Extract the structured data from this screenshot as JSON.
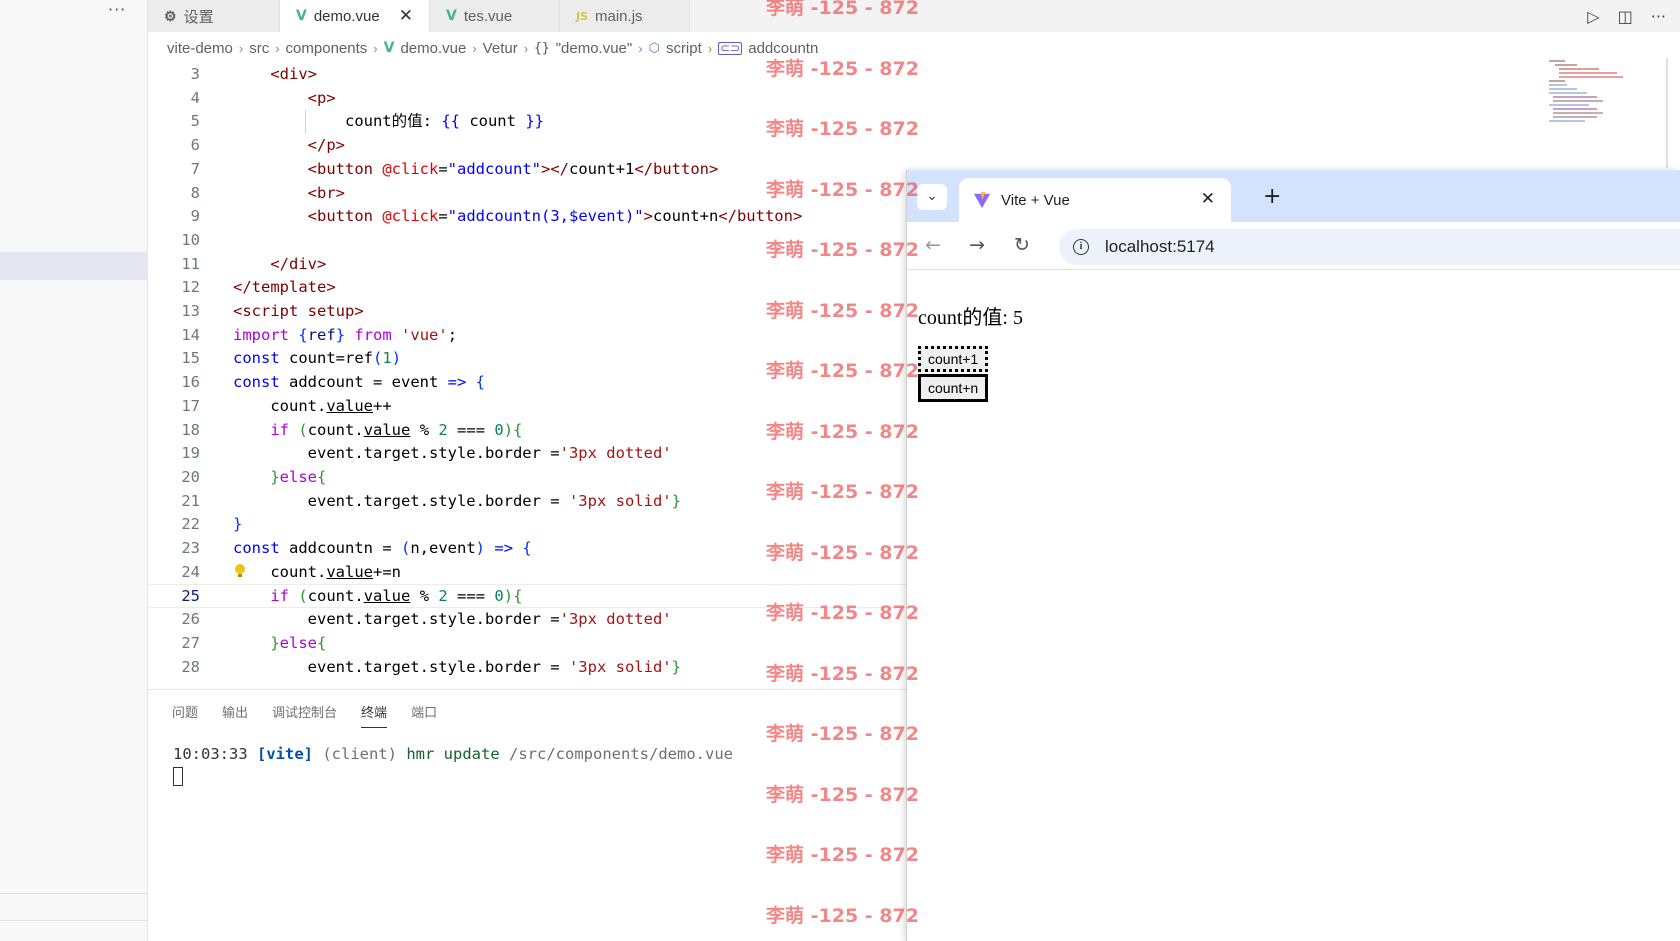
{
  "tabs": [
    {
      "label": "设置",
      "icon": "settings-icon"
    },
    {
      "label": "demo.vue",
      "icon": "vue-icon",
      "active": true
    },
    {
      "label": "tes.vue",
      "icon": "vue-icon"
    },
    {
      "label": "main.js",
      "icon": "js-icon"
    }
  ],
  "breadcrumb": {
    "items": [
      "vite-demo",
      "src",
      "components",
      "demo.vue",
      "Vetur",
      "\"demo.vue\"",
      "script",
      "addcountn"
    ]
  },
  "editor": {
    "current_line": 25,
    "lines": [
      {
        "n": "3",
        "segs": [
          [
            "    ",
            "p"
          ],
          [
            "<div>",
            "tag"
          ]
        ]
      },
      {
        "n": "4",
        "segs": [
          [
            "        ",
            "p"
          ],
          [
            "<p>",
            "tag"
          ]
        ]
      },
      {
        "n": "5",
        "segs": [
          [
            "            count的值: ",
            "p"
          ],
          [
            "{{",
            "kw"
          ],
          [
            " count ",
            "p"
          ],
          [
            "}}",
            "kw"
          ]
        ]
      },
      {
        "n": "6",
        "segs": [
          [
            "        ",
            "p"
          ],
          [
            "</p>",
            "tag"
          ]
        ]
      },
      {
        "n": "7",
        "segs": [
          [
            "        ",
            "p"
          ],
          [
            "<button",
            "tag"
          ],
          [
            " ",
            "p"
          ],
          [
            "@click",
            "attr"
          ],
          [
            "=",
            "p"
          ],
          [
            "\"addcount\"",
            "str"
          ],
          [
            "></",
            "tag"
          ],
          [
            "count+1",
            "p"
          ],
          [
            "</button>",
            "tag"
          ]
        ]
      },
      {
        "n": "8",
        "segs": [
          [
            "        ",
            "p"
          ],
          [
            "<br>",
            "tag"
          ]
        ]
      },
      {
        "n": "9",
        "segs": [
          [
            "        ",
            "p"
          ],
          [
            "<button",
            "tag"
          ],
          [
            " ",
            "p"
          ],
          [
            "@click",
            "attr"
          ],
          [
            "=",
            "p"
          ],
          [
            "\"addcountn(3,$event)\"",
            "str"
          ],
          [
            ">",
            "tag"
          ],
          [
            "count+n",
            "p"
          ],
          [
            "</button>",
            "tag"
          ]
        ]
      },
      {
        "n": "10",
        "segs": [
          [
            "",
            "p"
          ]
        ]
      },
      {
        "n": "11",
        "segs": [
          [
            "    ",
            "p"
          ],
          [
            "</div>",
            "tag"
          ]
        ]
      },
      {
        "n": "12",
        "segs": [
          [
            "</template>",
            "tag"
          ]
        ]
      },
      {
        "n": "13",
        "segs": [
          [
            "<script setup>",
            "tag"
          ]
        ]
      },
      {
        "n": "14",
        "segs": [
          [
            "import",
            "ctl"
          ],
          [
            " ",
            "p"
          ],
          [
            "{",
            "br"
          ],
          [
            "ref",
            "var"
          ],
          [
            "}",
            "br"
          ],
          [
            " ",
            "p"
          ],
          [
            "from",
            "ctl"
          ],
          [
            " ",
            "p"
          ],
          [
            "'vue'",
            "strq"
          ],
          [
            ";",
            "p"
          ]
        ]
      },
      {
        "n": "15",
        "segs": [
          [
            "const",
            "kw"
          ],
          [
            " count=ref",
            "p"
          ],
          [
            "(",
            "br"
          ],
          [
            "1",
            "num"
          ],
          [
            ")",
            "br"
          ]
        ]
      },
      {
        "n": "16",
        "segs": [
          [
            "const",
            "kw"
          ],
          [
            " addcount = event ",
            "p"
          ],
          [
            "=>",
            "kw"
          ],
          [
            " ",
            "p"
          ],
          [
            "{",
            "br"
          ]
        ]
      },
      {
        "n": "17",
        "segs": [
          [
            "    count.",
            "p"
          ],
          [
            "value",
            "u"
          ],
          [
            "++",
            "p"
          ]
        ]
      },
      {
        "n": "18",
        "segs": [
          [
            "    ",
            "p"
          ],
          [
            "if",
            "ctl"
          ],
          [
            " ",
            "p"
          ],
          [
            "(",
            "br2"
          ],
          [
            "count.",
            "p"
          ],
          [
            "value",
            "u"
          ],
          [
            " % ",
            "p"
          ],
          [
            "2",
            "num"
          ],
          [
            " === ",
            "p"
          ],
          [
            "0",
            "num"
          ],
          [
            ")",
            "br2"
          ],
          [
            "{",
            "br2"
          ]
        ]
      },
      {
        "n": "19",
        "segs": [
          [
            "        event.target.style.border =",
            "p"
          ],
          [
            "'3px dotted'",
            "strq"
          ]
        ]
      },
      {
        "n": "20",
        "segs": [
          [
            "    ",
            "p"
          ],
          [
            "}",
            "br2"
          ],
          [
            "else",
            "ctl"
          ],
          [
            "{",
            "br2"
          ]
        ]
      },
      {
        "n": "21",
        "segs": [
          [
            "        event.target.style.border = ",
            "p"
          ],
          [
            "'3px solid'",
            "strq"
          ],
          [
            "}",
            "br2"
          ]
        ]
      },
      {
        "n": "22",
        "segs": [
          [
            "}",
            "br"
          ]
        ]
      },
      {
        "n": "23",
        "segs": [
          [
            "const",
            "kw"
          ],
          [
            " addcountn = ",
            "p"
          ],
          [
            "(",
            "br"
          ],
          [
            "n,event",
            "p"
          ],
          [
            ")",
            "br"
          ],
          [
            " ",
            "p"
          ],
          [
            "=>",
            "kw"
          ],
          [
            " ",
            "p"
          ],
          [
            "{",
            "br"
          ]
        ]
      },
      {
        "n": "24",
        "segs": [
          [
            "    count.",
            "p"
          ],
          [
            "value",
            "u"
          ],
          [
            "+=n",
            "p"
          ]
        ]
      },
      {
        "n": "25",
        "segs": [
          [
            "    ",
            "p"
          ],
          [
            "if",
            "ctl"
          ],
          [
            " ",
            "p"
          ],
          [
            "(",
            "br2"
          ],
          [
            "count.",
            "p"
          ],
          [
            "value",
            "u"
          ],
          [
            " % ",
            "p"
          ],
          [
            "2",
            "num"
          ],
          [
            " === ",
            "p"
          ],
          [
            "0",
            "num"
          ],
          [
            ")",
            "br2"
          ],
          [
            "{",
            "br2"
          ]
        ]
      },
      {
        "n": "26",
        "segs": [
          [
            "        event.target.style.border =",
            "p"
          ],
          [
            "'3px dotted'",
            "strq"
          ]
        ]
      },
      {
        "n": "27",
        "segs": [
          [
            "    ",
            "p"
          ],
          [
            "}",
            "br2"
          ],
          [
            "else",
            "ctl"
          ],
          [
            "{",
            "br2"
          ]
        ]
      },
      {
        "n": "28",
        "segs": [
          [
            "        event.target.style.border = ",
            "p"
          ],
          [
            "'3px solid'",
            "strq"
          ],
          [
            "}",
            "br2"
          ]
        ]
      }
    ]
  },
  "panel": {
    "tabs": [
      "问题",
      "输出",
      "调试控制台",
      "终端",
      "端口"
    ],
    "active_tab": "终端",
    "terminal": {
      "time": "10:03:33",
      "tag": "[vite]",
      "client": "(client)",
      "action": "hmr update",
      "path": "/src/components/demo.vue"
    }
  },
  "watermark": {
    "text": "李萌 -125 - 872",
    "repeat_count": 16
  },
  "browser": {
    "tab_title": "Vite + Vue",
    "url": "localhost:5174",
    "page": {
      "count_text": "count的值: 5",
      "button1_label": "count+1",
      "button2_label": "count+n"
    }
  },
  "colors": {
    "accent_vue": "#41b883",
    "watermark": "#eb5a5a",
    "browser_tabstrip": "#d3e3fd"
  }
}
